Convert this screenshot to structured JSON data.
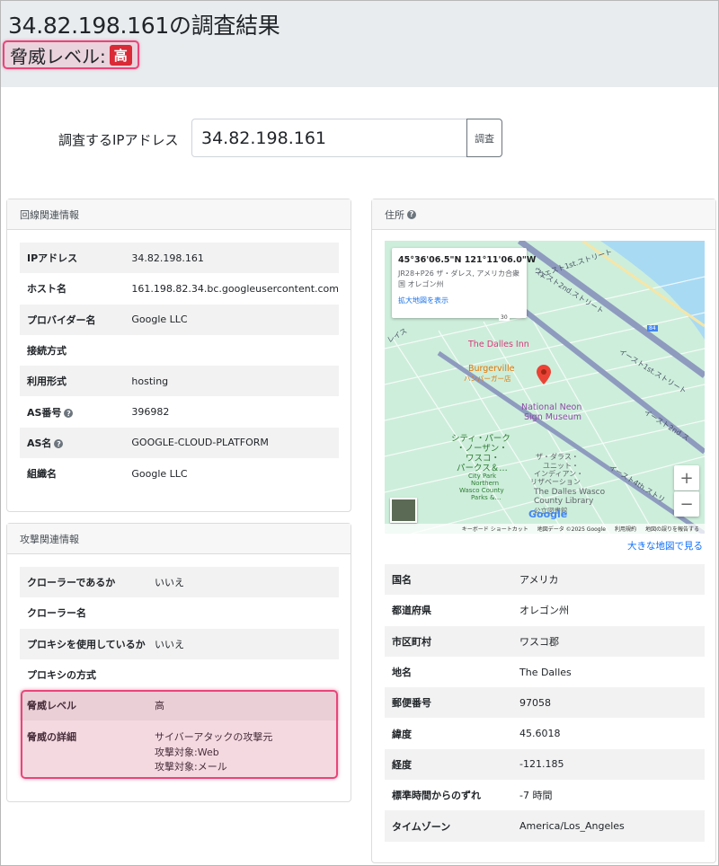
{
  "header": {
    "title": "34.82.198.161の調査結果",
    "threat_label": "脅威レベル:",
    "threat_badge": "高"
  },
  "search": {
    "label": "調査するIPアドレス",
    "value": "34.82.198.161",
    "button": "調査"
  },
  "line_info": {
    "title": "回線関連情報",
    "rows": [
      {
        "key": "IPアドレス",
        "value": "34.82.198.161"
      },
      {
        "key": "ホスト名",
        "value": "161.198.82.34.bc.googleusercontent.com"
      },
      {
        "key": "プロバイダー名",
        "value": "Google LLC"
      },
      {
        "key": "接続方式",
        "value": ""
      },
      {
        "key": "利用形式",
        "value": "hosting"
      },
      {
        "key": "AS番号",
        "value": "396982"
      },
      {
        "key": "AS名",
        "value": "GOOGLE-CLOUD-PLATFORM"
      },
      {
        "key": "組織名",
        "value": "Google LLC"
      }
    ]
  },
  "attack_info": {
    "title": "攻撃関連情報",
    "rows": [
      {
        "key": "クローラーであるか",
        "value": "いいえ"
      },
      {
        "key": "クローラー名",
        "value": ""
      },
      {
        "key": "プロキシを使用しているか",
        "value": "いいえ"
      },
      {
        "key": "プロキシの方式",
        "value": ""
      },
      {
        "key": "脅威レベル",
        "value": "高"
      }
    ],
    "detail_key": "脅威の詳細",
    "detail_lines": [
      "サイバーアタックの攻撃元",
      "攻撃対象:Web",
      "攻撃対象:メール"
    ]
  },
  "address": {
    "title": "住所",
    "map": {
      "coord": "45°36'06.5\"N 121°11'06.0\"W",
      "addr": "JR28+P26 ザ・ダレス, アメリカ合衆国 オレゴン州",
      "link": "拡大地図を表示",
      "labels": {
        "inn": "The Dalles Inn",
        "burger": "Burgerville",
        "burger_sub": "ハンバーガー店",
        "neon1": "National Neon",
        "neon2": "Sign Museum",
        "park1": "シティ・パーク",
        "park2": "・ノーザン・",
        "park3": "ワスコ・",
        "park4": "パークス＆…",
        "park_en1": "City Park",
        "park_en2": "Northern",
        "park_en3": "Wasco County",
        "park_en4": "Parks &…",
        "lib_jp1": "ザ・ダラス・",
        "lib_jp2": "ユニット・",
        "lib_jp3": "インディアン・",
        "lib_jp4": "リザベーション",
        "lib1": "The Dalles Wasco",
        "lib2": "County Library",
        "lib3": "公立図書館",
        "street1": "ウェスト1st.ストリート",
        "street2": "ウェスト2nd.ストリート",
        "street3": "イースト1st.ストリート",
        "street4": "イースト2nd.ス",
        "street5": "イースト4th.ストリ",
        "street6": "レイス",
        "road30": "30",
        "road84": "84",
        "google": "Google"
      },
      "footer": [
        "キーボード ショートカット",
        "地図データ ©2025 Google",
        "利用規約",
        "地図の誤りを報告する"
      ]
    },
    "bigmap_link": "大きな地図で見る",
    "rows": [
      {
        "key": "国名",
        "value": "アメリカ"
      },
      {
        "key": "都道府県",
        "value": "オレゴン州"
      },
      {
        "key": "市区町村",
        "value": "ワスコ郡"
      },
      {
        "key": "地名",
        "value": "The Dalles"
      },
      {
        "key": "郵便番号",
        "value": "97058"
      },
      {
        "key": "緯度",
        "value": "45.6018"
      },
      {
        "key": "経度",
        "value": "-121.185"
      },
      {
        "key": "標準時間からのずれ",
        "value": "-7 時間"
      },
      {
        "key": "タイムゾーン",
        "value": "America/Los_Angeles"
      }
    ]
  },
  "colors": {
    "highlight": "#e8457a",
    "badge": "#d92a36",
    "link": "#0d6efd"
  }
}
